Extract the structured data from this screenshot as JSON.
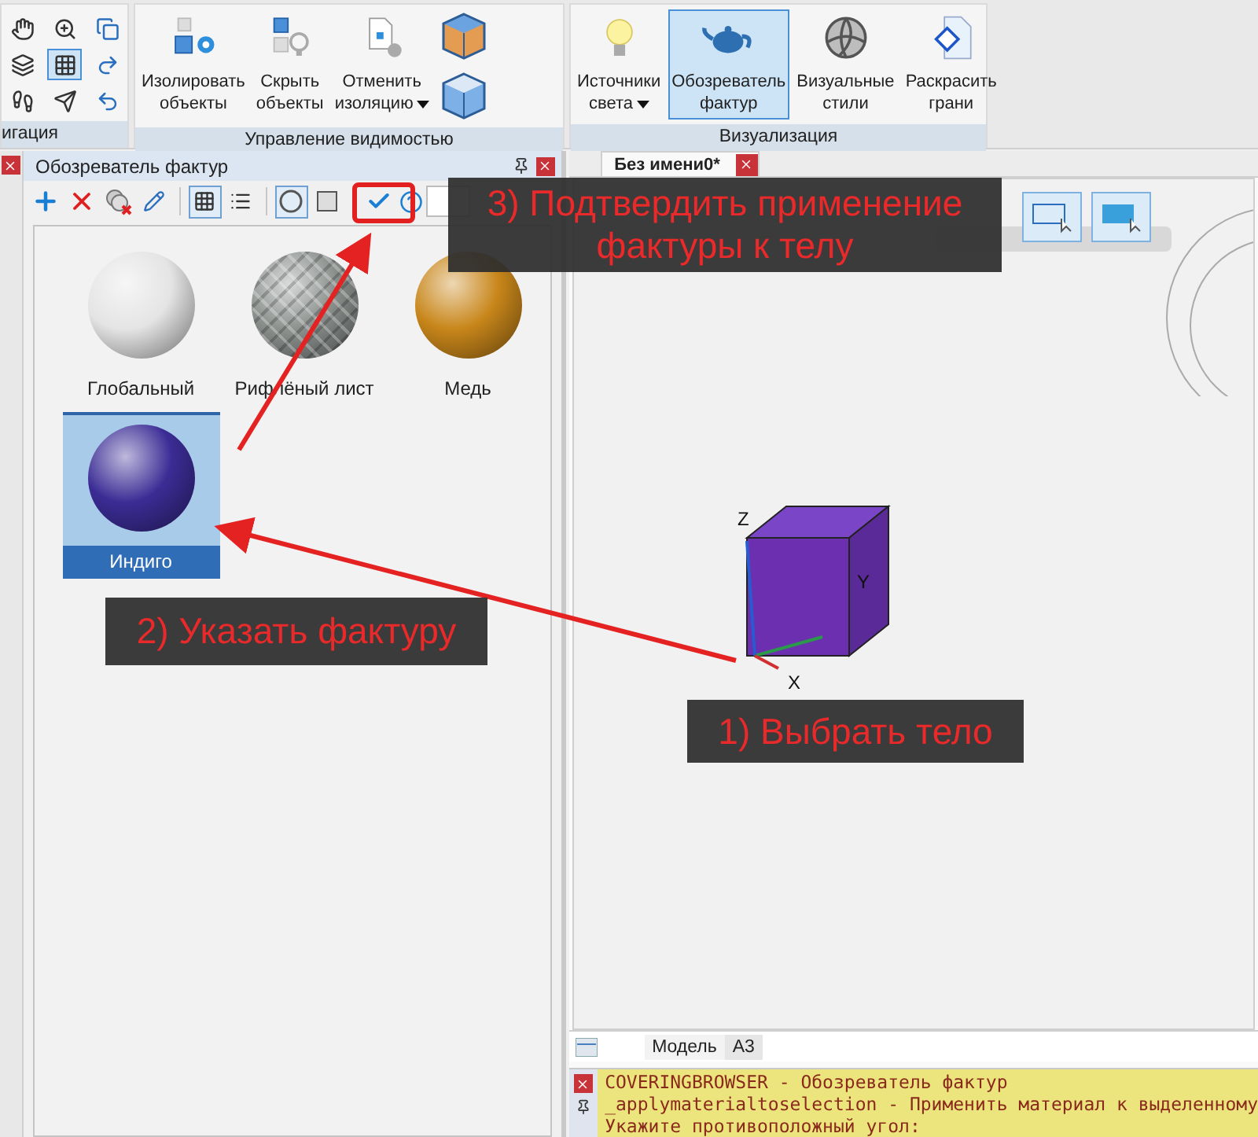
{
  "ribbon": {
    "groups": [
      {
        "title": "игация",
        "kind": "nav"
      },
      {
        "title": "Управление видимостью",
        "kind": "visibility",
        "buttons": [
          {
            "lines": [
              "Изолировать",
              "объекты"
            ],
            "dropdown": false
          },
          {
            "lines": [
              "Скрыть",
              "объекты"
            ],
            "dropdown": false
          },
          {
            "lines": [
              "Отменить",
              "изоляцию"
            ],
            "dropdown": true
          }
        ]
      },
      {
        "title": "Визуализация",
        "kind": "visual",
        "buttons": [
          {
            "lines": [
              "Источники",
              "света"
            ],
            "dropdown": true,
            "selected": false
          },
          {
            "lines": [
              "Обозреватель",
              "фактур"
            ],
            "dropdown": false,
            "selected": true
          },
          {
            "lines": [
              "Визуальные",
              "стили"
            ],
            "dropdown": false,
            "selected": false
          },
          {
            "lines": [
              "Раскрасить",
              "грани"
            ],
            "dropdown": false,
            "selected": false
          }
        ]
      }
    ]
  },
  "panel": {
    "title": "Обозреватель фактур",
    "view_modes": [
      {
        "kind": "grid",
        "selected": true
      },
      {
        "kind": "list",
        "selected": false
      }
    ],
    "preview_shapes": [
      {
        "kind": "sphere",
        "selected": true
      },
      {
        "kind": "cube",
        "selected": false
      }
    ],
    "materials": [
      {
        "name": "Глобальный",
        "kind": "plain",
        "color": "#e4e4e4",
        "selected": false
      },
      {
        "name": "Рифлёный лист",
        "kind": "plate",
        "color": "#8c918e",
        "selected": false
      },
      {
        "name": "Медь",
        "kind": "plain",
        "color": "#c8861a",
        "selected": false
      },
      {
        "name": "Индиго",
        "kind": "plain",
        "color": "#3b2c95",
        "selected": true
      }
    ]
  },
  "document": {
    "tab": "Без имени0*",
    "axes": [
      "Z",
      "Y",
      "X"
    ],
    "layout_tabs": [
      {
        "label": "Модель",
        "selected": true
      },
      {
        "label": "А3",
        "selected": false
      }
    ],
    "command_lines": [
      "COVERINGBROWSER - Обозреватель фактур",
      "_applymaterialtoselection - Применить материал к выделенному",
      "Укажите противоположный угол:"
    ]
  },
  "callouts": [
    {
      "lines": [
        "3) Подтвердить применение",
        "фактуры к телу"
      ]
    },
    {
      "lines": [
        "2) Указать фактуру"
      ]
    },
    {
      "lines": [
        "1) Выбрать тело"
      ]
    }
  ]
}
